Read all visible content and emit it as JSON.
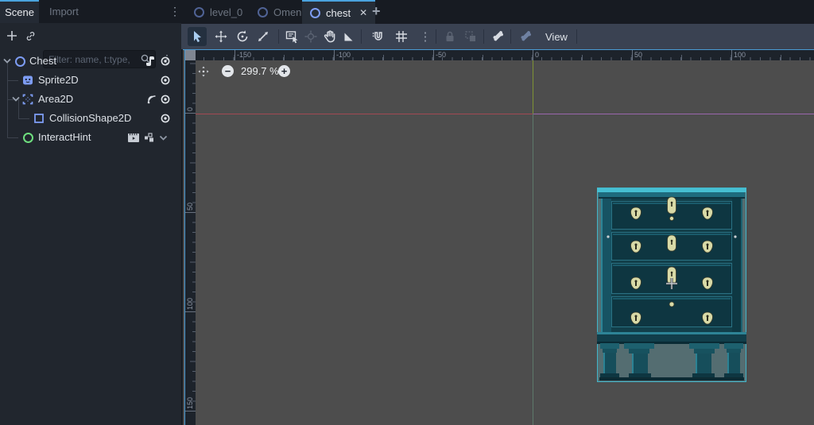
{
  "dock": {
    "tabs": {
      "scene": "Scene",
      "import": "Import"
    },
    "filter": {
      "placeholder": "Filter: name, t:type,"
    },
    "tree": [
      {
        "name": "Chest"
      },
      {
        "name": "Sprite2D"
      },
      {
        "name": "Area2D"
      },
      {
        "name": "CollisionShape2D"
      },
      {
        "name": "InteractHint"
      }
    ]
  },
  "scene_tabs": {
    "level_0": "level_0",
    "omen": "Omen",
    "chest": "chest",
    "close": "✕",
    "add": "+"
  },
  "toolbar": {
    "view": "View",
    "snap_menu_dots": "⋮"
  },
  "panel_menu_dots": "⋮",
  "viewport": {
    "zoom": "299.7 %",
    "h_ruler": [
      "-150",
      "-100",
      "-50",
      "0",
      "50",
      "100"
    ],
    "v_ruler": [
      "0",
      "50",
      "100",
      "150"
    ]
  },
  "colors": {
    "accent_blue": "#4aa3de",
    "panel_bg": "#21262e",
    "canvas_bg": "#4d4d4d",
    "axis_x_red": "#a34853",
    "axis_y_green": "#7e9334",
    "viewport_rect_violet": "#9a66ad",
    "collision_shape_teal": "#41b5c9",
    "node2d_icon_blue": "#7d9cf3",
    "control_icon_green": "#6ede7e"
  },
  "icons": {
    "select-tool-icon": "cursor arrow",
    "move-tool-icon": "cross arrows",
    "rotate-tool-icon": "circular arrow",
    "scale-tool-icon": "diagonal arrows",
    "list-select-icon": "list with cursor",
    "pick-pivot-icon": "crosshair",
    "pan-tool-icon": "hand",
    "ruler-tool-icon": "triangle",
    "smart-snap-icon": "magnet",
    "grid-snap-icon": "grid",
    "lock-icon": "padlock",
    "group-icon": "squares",
    "bone-icon": "bone",
    "skeleton-options-icon": "bone blue",
    "visibility-icon": "circle-dot eye",
    "script-icon": "scroll",
    "signal-icon": "radio arcs",
    "search-icon": "magnifier",
    "link-icon": "chain",
    "add-icon": "plus"
  }
}
